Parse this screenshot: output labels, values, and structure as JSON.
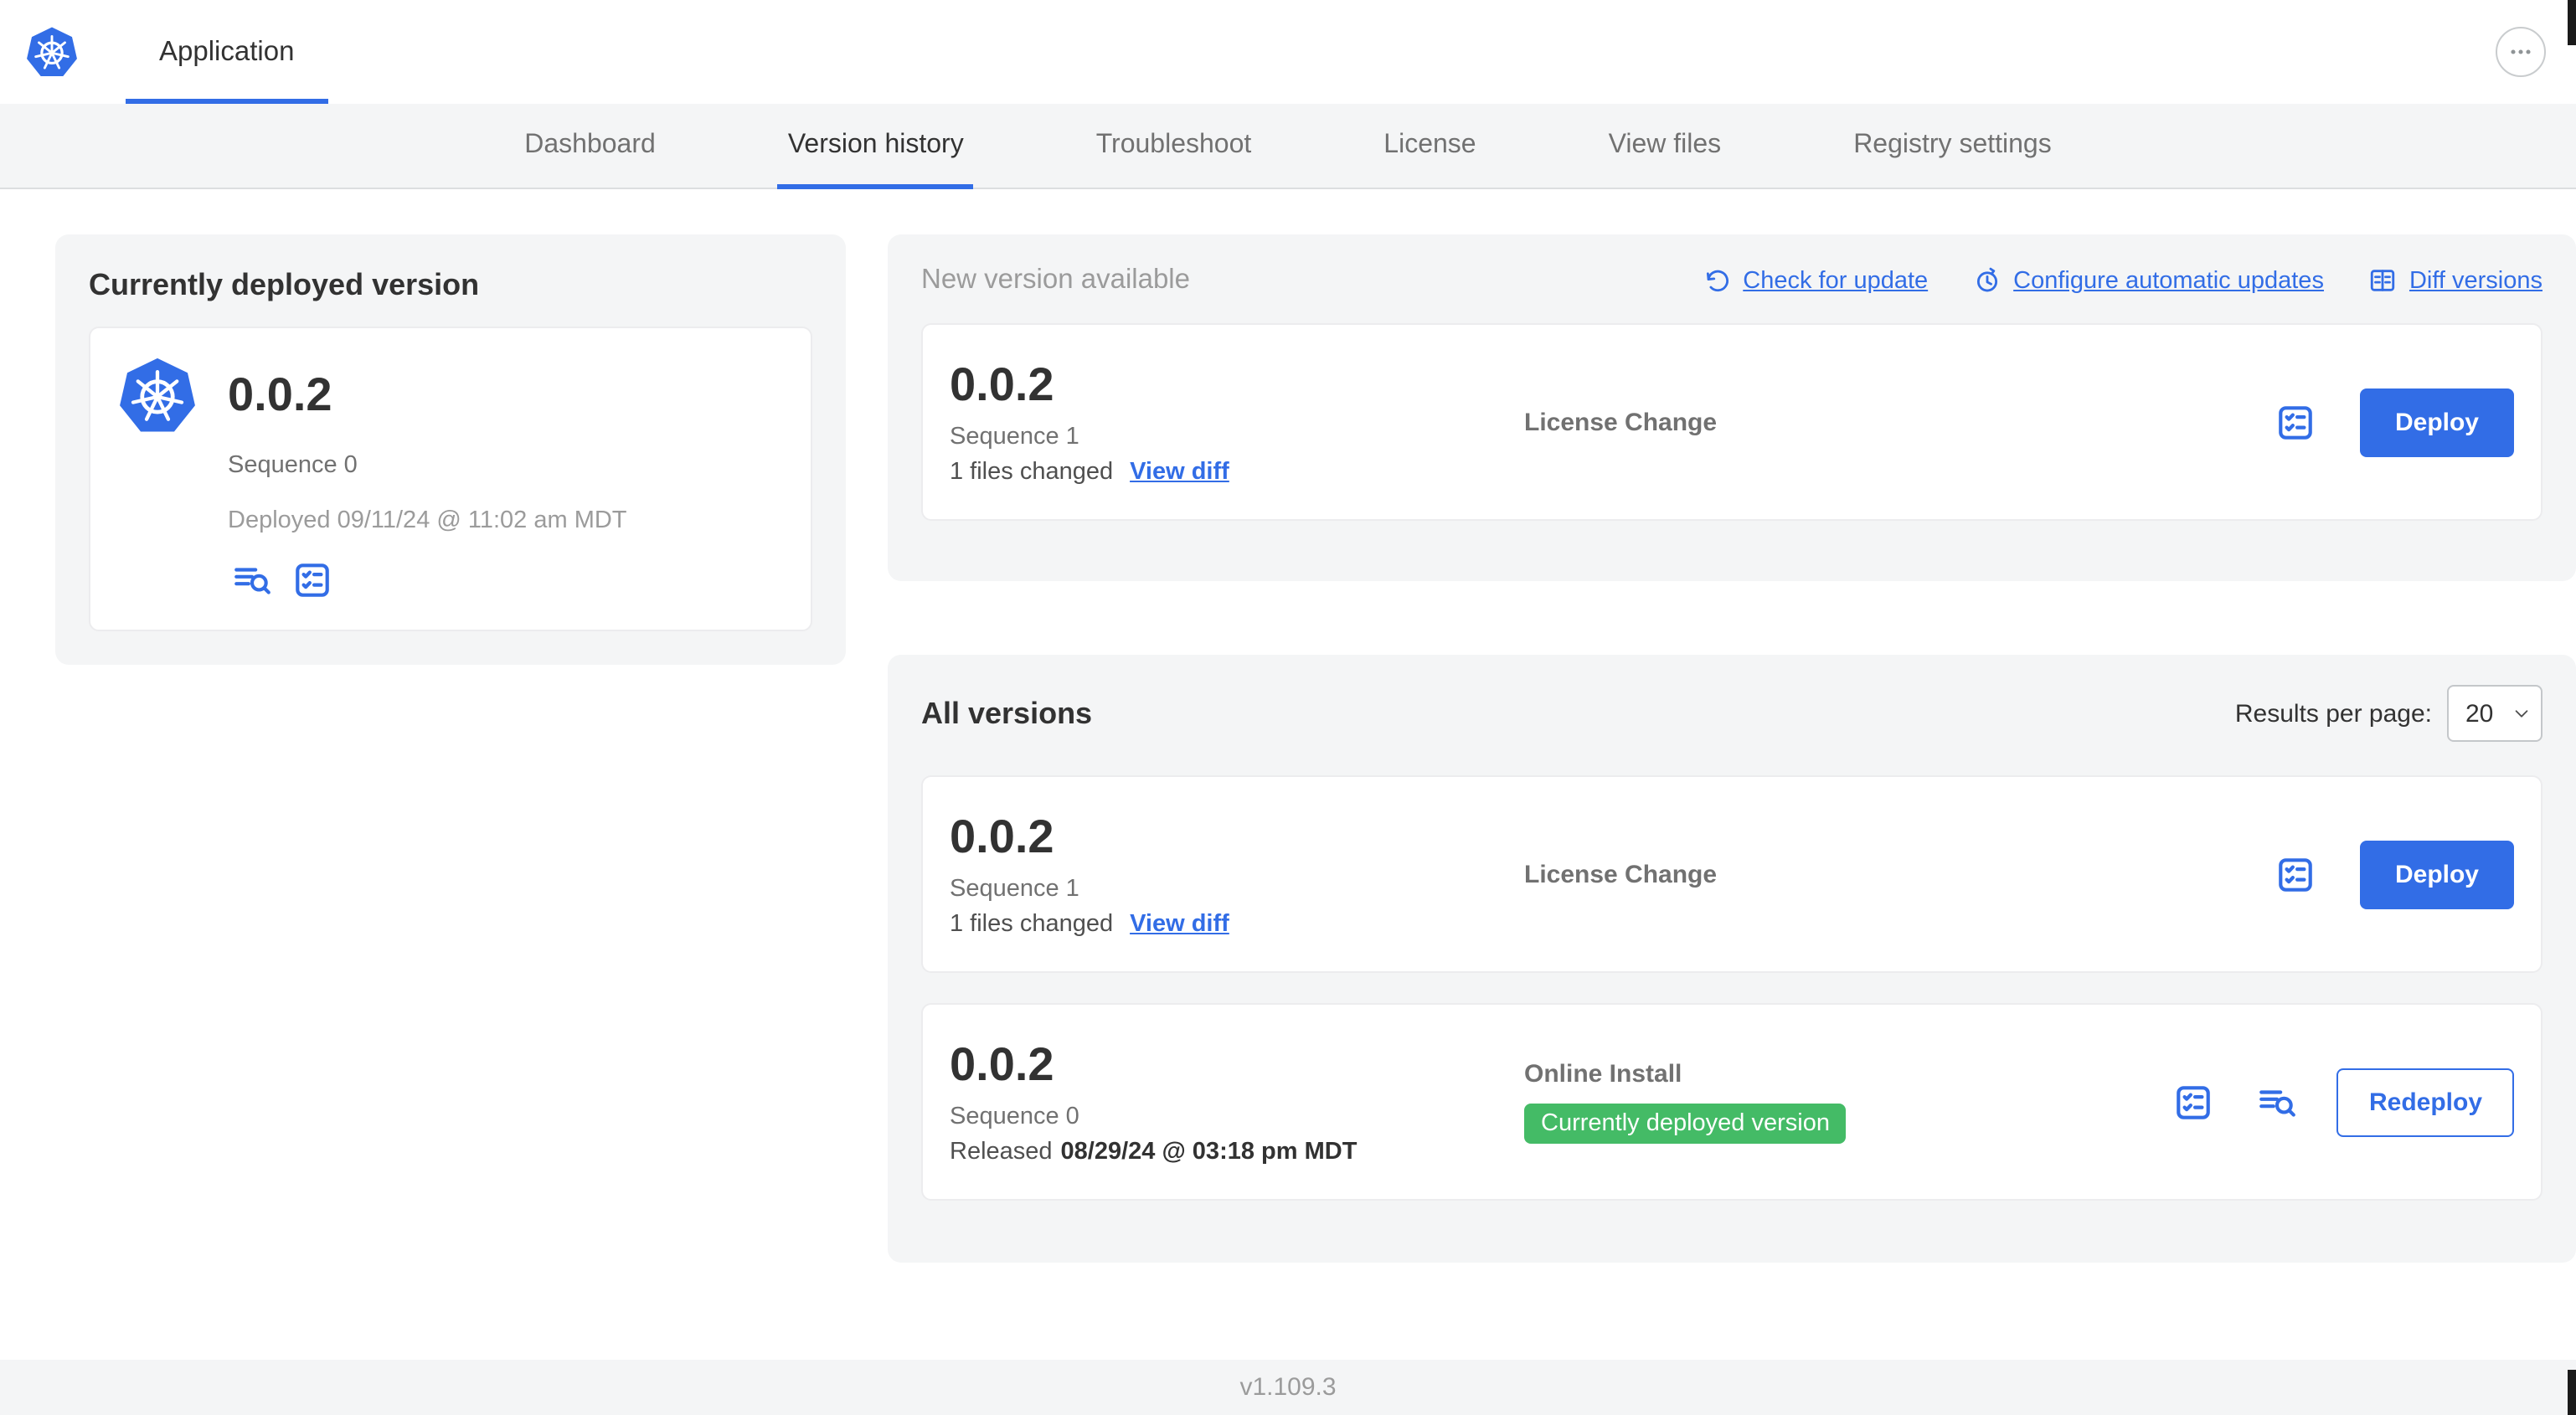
{
  "header": {
    "app_tab": "Application",
    "more_icon": "ellipsis-icon"
  },
  "nav": {
    "tabs": [
      {
        "label": "Dashboard",
        "active": false
      },
      {
        "label": "Version history",
        "active": true
      },
      {
        "label": "Troubleshoot",
        "active": false
      },
      {
        "label": "License",
        "active": false
      },
      {
        "label": "View files",
        "active": false
      },
      {
        "label": "Registry settings",
        "active": false
      }
    ]
  },
  "current_version": {
    "title": "Currently deployed version",
    "icon": "kubernetes-logo",
    "version": "0.0.2",
    "sequence": "Sequence 0",
    "deployed": "Deployed 09/11/24 @ 11:02 am MDT",
    "icon_buttons": [
      "deploy-logs-icon",
      "release-notes-icon"
    ]
  },
  "new_version": {
    "title": "New version available",
    "actions": [
      {
        "label": "Check for update",
        "icon": "refresh-icon"
      },
      {
        "label": "Configure automatic updates",
        "icon": "clock-arrow-icon"
      },
      {
        "label": "Diff versions",
        "icon": "diff-icon"
      }
    ],
    "row": {
      "version": "0.0.2",
      "sequence": "Sequence 1",
      "files_changed": "1 files changed",
      "view_diff": "View diff",
      "source": "License Change",
      "icon_buttons": [
        "release-notes-icon"
      ],
      "deploy_label": "Deploy"
    }
  },
  "all_versions": {
    "title": "All versions",
    "results_per_page_label": "Results per page:",
    "results_per_page_value": "20",
    "rows": [
      {
        "version": "0.0.2",
        "sequence": "Sequence 1",
        "files_changed": "1 files changed",
        "view_diff": "View diff",
        "source": "License Change",
        "icon_buttons": [
          "release-notes-icon"
        ],
        "deploy_label": "Deploy"
      },
      {
        "version": "0.0.2",
        "sequence": "Sequence 0",
        "released_prefix": "Released",
        "released_date": "08/29/24 @ 03:18 pm MDT",
        "source": "Online Install",
        "badge": "Currently deployed version",
        "icon_buttons": [
          "release-notes-icon",
          "deploy-logs-icon"
        ],
        "action_label": "Redeploy"
      }
    ]
  },
  "footer": {
    "version": "v1.109.3"
  },
  "colors": {
    "accent": "#326de6",
    "badge_green": "#44bb66",
    "text_dark": "#323232",
    "text_muted": "#717171",
    "text_faint": "#9b9b9b",
    "card_gray": "#f4f5f6"
  }
}
